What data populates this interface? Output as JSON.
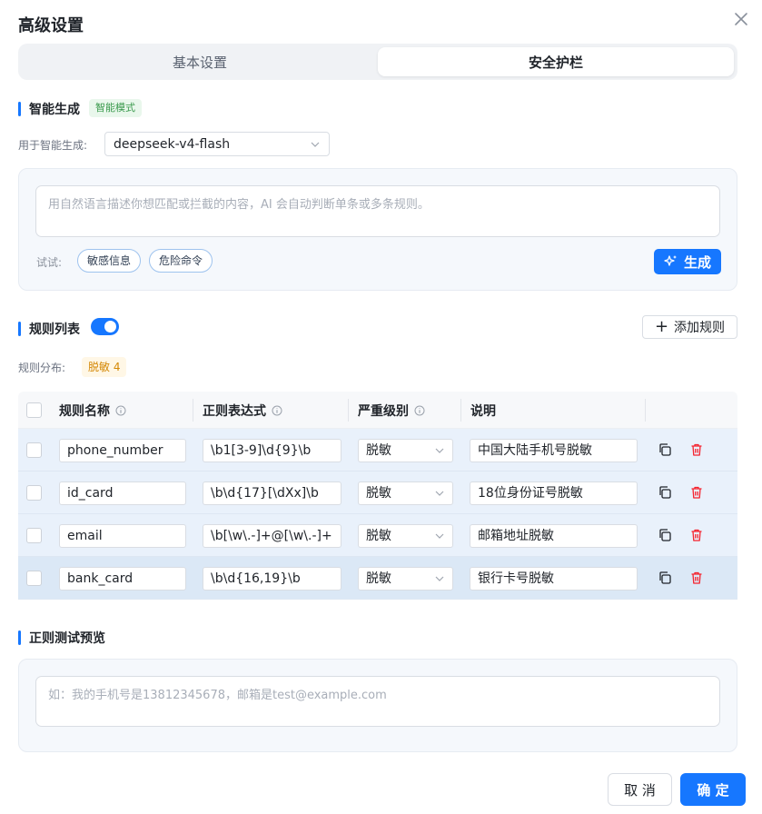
{
  "dialog": {
    "title": "高级设置"
  },
  "tabs": [
    {
      "label": "基本设置",
      "active": false
    },
    {
      "label": "安全护栏",
      "active": true
    }
  ],
  "smart_gen": {
    "title": "智能生成",
    "mode_badge": "智能模式",
    "model_label": "用于智能生成:",
    "model_value": "deepseek-v4-flash",
    "input_placeholder": "用自然语言描述你想匹配或拦截的内容，AI 会自动判断单条或多条规则。",
    "try_label": "试试:",
    "suggestions": [
      "敏感信息",
      "危险命令"
    ],
    "generate_label": "生成"
  },
  "rules": {
    "title": "规则列表",
    "enabled": true,
    "add_label": "添加规则",
    "distribution_label": "规则分布:",
    "distribution_badge": "脱敏 4",
    "columns": {
      "name": "规则名称",
      "regex": "正则表达式",
      "severity": "严重级别",
      "description": "说明"
    },
    "rows": [
      {
        "name": "phone_number",
        "regex": "\\b1[3-9]\\d{9}\\b",
        "severity": "脱敏",
        "description": "中国大陆手机号脱敏"
      },
      {
        "name": "id_card",
        "regex": "\\b\\d{17}[\\dXx]\\b",
        "severity": "脱敏",
        "description": "18位身份证号脱敏"
      },
      {
        "name": "email",
        "regex": "\\b[\\w\\.-]+@[\\w\\.-]+",
        "severity": "脱敏",
        "description": "邮箱地址脱敏"
      },
      {
        "name": "bank_card",
        "regex": "\\b\\d{16,19}\\b",
        "severity": "脱敏",
        "description": "银行卡号脱敏"
      }
    ]
  },
  "preview": {
    "title": "正则测试预览",
    "placeholder": "如：我的手机号是13812345678，邮箱是test@example.com"
  },
  "footer": {
    "cancel_label": "取 消",
    "ok_label": "确 定"
  },
  "colors": {
    "primary": "#1677ff",
    "danger": "#f5222d",
    "success_badge_text": "#3a9a4d",
    "warning_badge_text": "#d48806"
  }
}
